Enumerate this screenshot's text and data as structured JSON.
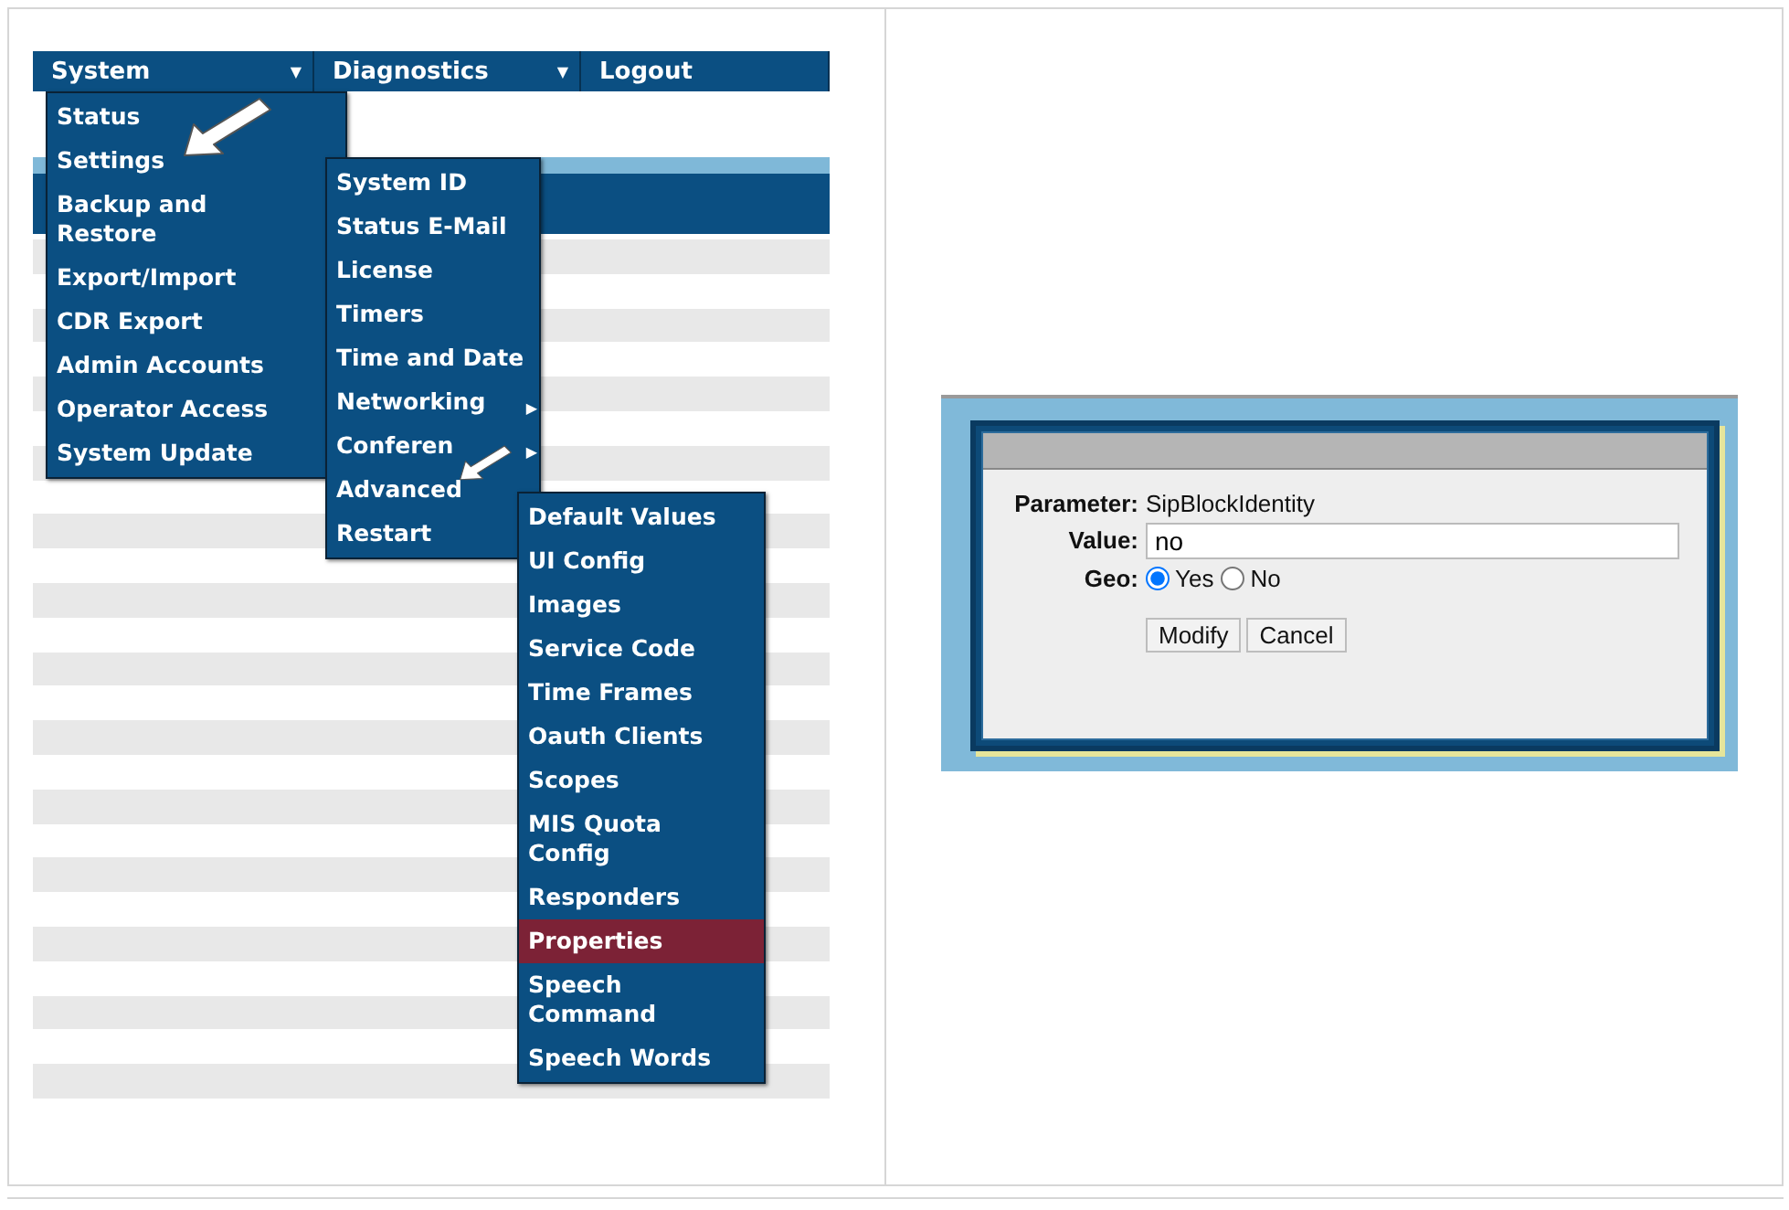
{
  "left_screenshot": {
    "menubar": [
      {
        "label": "System",
        "caret": "▼"
      },
      {
        "label": "Diagnostics",
        "caret": "▼"
      },
      {
        "label": "Logout"
      }
    ],
    "menus": [
      {
        "items": [
          {
            "label": "Status",
            "selected": false
          },
          {
            "label": "Settings",
            "selected": false
          },
          {
            "label": "Backup and Restore",
            "selected": false
          },
          {
            "label": "Export/Import",
            "selected": false
          },
          {
            "label": "CDR Export",
            "selected": false
          },
          {
            "label": "Admin Accounts",
            "selected": false
          },
          {
            "label": "Operator Access",
            "selected": false
          },
          {
            "label": "System Update",
            "selected": false
          }
        ]
      },
      {
        "items": [
          {
            "label": "System ID",
            "selected": false
          },
          {
            "label": "Status E-Mail",
            "selected": false
          },
          {
            "label": "License",
            "selected": false
          },
          {
            "label": "Timers",
            "selected": false
          },
          {
            "label": "Time and Date",
            "selected": false
          },
          {
            "label": "Networking",
            "arrow": "▶",
            "selected": false
          },
          {
            "label": "Conferen",
            "arrow": "▶",
            "selected": false
          },
          {
            "label": "Advanced",
            "selected": false
          },
          {
            "label": "Restart",
            "selected": false
          }
        ]
      },
      {
        "items": [
          {
            "label": "Default Values",
            "selected": false
          },
          {
            "label": "UI Config",
            "selected": false
          },
          {
            "label": "Images",
            "selected": false
          },
          {
            "label": "Service Code",
            "selected": false
          },
          {
            "label": "Time Frames",
            "selected": false
          },
          {
            "label": "Oauth Clients",
            "selected": false
          },
          {
            "label": "Scopes",
            "selected": false
          },
          {
            "label": "MIS Quota Config",
            "selected": false
          },
          {
            "label": "Responders",
            "selected": false
          },
          {
            "label": "Properties",
            "selected": true
          },
          {
            "label": "Speech Command",
            "selected": false
          },
          {
            "label": "Speech Words",
            "selected": false
          }
        ]
      }
    ]
  },
  "dialog": {
    "fields": [
      {
        "kind": "text",
        "label": "Parameter:",
        "value": "SipBlockIdentity"
      },
      {
        "kind": "input",
        "label": "Value:",
        "value": "no"
      },
      {
        "kind": "radio",
        "label": "Geo:",
        "options": [
          {
            "label": "Yes",
            "selected": true
          },
          {
            "label": "No",
            "selected": false
          }
        ]
      }
    ],
    "buttons": [
      "Modify",
      "Cancel"
    ]
  }
}
